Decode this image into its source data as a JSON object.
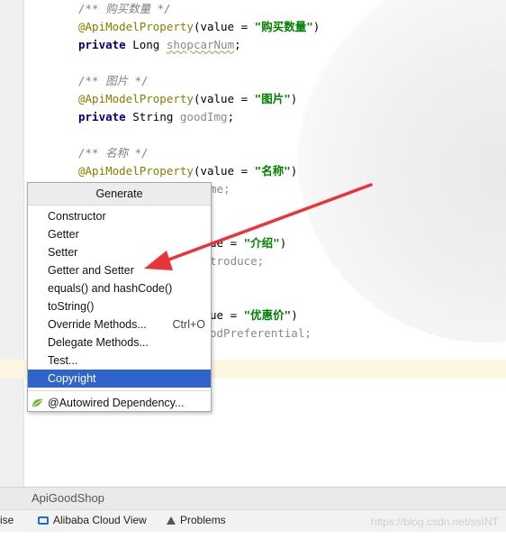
{
  "code": {
    "lines": [
      {
        "comment": "/** 购买数量 */"
      },
      {
        "annotation": "@ApiModelProperty",
        "paren_open": "(value = ",
        "string": "\"购买数量\"",
        "paren_close": ")"
      },
      {
        "keyword": "private",
        "type": " Long ",
        "field": "shopcarNum",
        "semicolon": ";"
      },
      {
        "comment": "/** 图片 */"
      },
      {
        "annotation": "@ApiModelProperty",
        "paren_open": "(value = ",
        "string": "\"图片\"",
        "paren_close": ")"
      },
      {
        "keyword": "private",
        "type": " String ",
        "field": "goodImg",
        "semicolon": ";"
      },
      {
        "comment": "/** 名称 */"
      },
      {
        "annotation": "@ApiModelProperty",
        "paren_open": "(value = ",
        "string": "\"名称\"",
        "paren_close": ")"
      },
      {
        "fragment": "me;"
      },
      {
        "fragment_a": "ue = ",
        "string": "\"介绍\"",
        "fragment_b": ")"
      },
      {
        "fragment": "troduce;"
      },
      {
        "fragment_a": "ue = ",
        "string": "\"优惠价\"",
        "fragment_b": ")"
      },
      {
        "fragment": "odPreferential;"
      }
    ]
  },
  "popup": {
    "title": "Generate",
    "items": [
      {
        "label": "Constructor",
        "shortcut": ""
      },
      {
        "label": "Getter",
        "shortcut": ""
      },
      {
        "label": "Setter",
        "shortcut": ""
      },
      {
        "label": "Getter and Setter",
        "shortcut": ""
      },
      {
        "label": "equals() and hashCode()",
        "shortcut": ""
      },
      {
        "label": "toString()",
        "shortcut": ""
      },
      {
        "label": "Override Methods...",
        "shortcut": "Ctrl+O"
      },
      {
        "label": "Delegate Methods...",
        "shortcut": ""
      },
      {
        "label": "Test...",
        "shortcut": ""
      },
      {
        "label": "Copyright",
        "shortcut": "",
        "selected": true
      }
    ],
    "extra_item": {
      "label": "@Autowired Dependency...",
      "icon": "spring-leaf-icon"
    }
  },
  "tool_window": {
    "title": "ApiGoodShop"
  },
  "statusbar": {
    "left_fragment": "ise",
    "alibaba_label": "Alibaba Cloud View",
    "problems_label": "Problems",
    "watermark": "https://blog.csdn.net/ssINT"
  },
  "colors": {
    "selection": "#2f65ca",
    "arrow": "#e8343a",
    "string": "#008000",
    "annotation": "#808000",
    "keyword": "#000080"
  }
}
